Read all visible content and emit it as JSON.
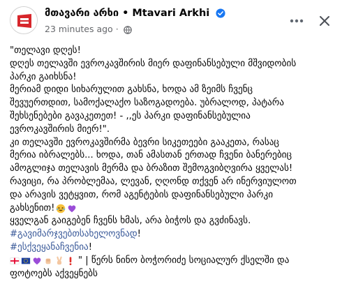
{
  "header": {
    "page_name": "მთავარი არხი • Mtavari Arkhi",
    "timestamp": "23 minutes ago",
    "separator": "·",
    "verified_icon": "verified-badge-icon",
    "privacy_icon": "globe-icon",
    "more_icon": "ellipsis-icon",
    "close_icon": "close-icon",
    "brand_color": "#d7262b",
    "verified_color": "#1877f2"
  },
  "post": {
    "lines": [
      "\"თელავი დღეს!",
      "დღეს თელავში ევროკავშირის მიერ დაფინანსებული მშვიდობის",
      "პარკი გაიხსნა!",
      "მერიამ დიდი სიხარულით გახსნა, ხოდა ამ ზეიმს ჩვენც",
      "შევუერთდით, სამოქალაქო საზოგადოება. უბრალოდ, პატარა",
      "შეხსენებები გავაკეთეთ!  - ,,ეს პარკი დაფინანსებულია",
      "ევროკავშირის მიერ!\".",
      "კი თელავში ევროკავშირმა ბევრი სიკეთეები გააკეთა, რასაც",
      "მერია იბრალებს... ხოდა, თან ამასთან ერთად ჩვენი ბანერებიც",
      "ამოგლიჯა თელავის მერმა და ბრაზით შემოგვიბღვირა ყველას!",
      "რავიცი, რა პრობლემაა, ლევან, ღღონდ თქვენ არ ინერვიულოთ",
      "და არავის ვეტყვით, რომ აგენტების დაფინანსებული პარკი",
      "გახსენით! "
    ],
    "line_13_emojis": [
      "grinning-squinting-tears-emoji",
      "purple-heart-emoji"
    ],
    "line_14": "ყველგან გაიგებენ ჩვენს ხმას, არა ბიჭოს და გვძინავს.",
    "hashtag_1": "#გავიმარჯვებთსახელოვნად",
    "hashtag_1_suffix": "!",
    "hashtag_2": "#ესქვეყანაჩვენია",
    "hashtag_2_suffix": "!",
    "emoji_row": [
      "georgia-flag-emoji",
      "eu-flag-emoji",
      "purple-heart-emoji",
      "raised-fist-emoji",
      "victory-hand-emoji",
      "exclamation-emoji"
    ],
    "closing_text_1": "\" | წერს ნინო ბოჭორიძე სოციალურ ქსელში და",
    "closing_text_2": "ფოტოებს აქვეყნებს",
    "hashtag_color": "#385898"
  }
}
